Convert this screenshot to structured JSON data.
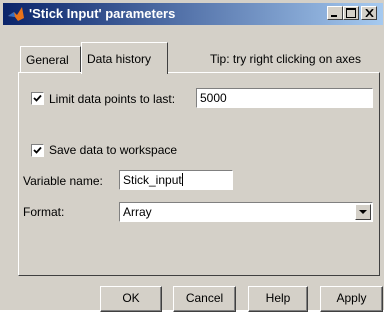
{
  "window": {
    "title": "'Stick Input' parameters",
    "accent": "#0a246a",
    "face_color": "#d4d0c8"
  },
  "tabs": [
    {
      "label": "General",
      "selected": false
    },
    {
      "label": "Data history",
      "selected": true
    }
  ],
  "tip": "Tip: try right clicking on axes",
  "data_history": {
    "limit_label": "Limit data points to last:",
    "limit_checked": true,
    "limit_value": "5000",
    "save_label": "Save data to workspace",
    "save_checked": true,
    "variable_label": "Variable name:",
    "variable_value": "Stick_input",
    "format_label": "Format:",
    "format_value": "Array"
  },
  "buttons": {
    "ok": "OK",
    "cancel": "Cancel",
    "help": "Help",
    "apply": "Apply"
  },
  "icons": {
    "app": "matlab-logo-icon",
    "minimize": "minimize-icon",
    "maximize": "maximize-icon",
    "close": "close-icon",
    "dropdown": "chevron-down-icon",
    "check": "checkmark-icon"
  }
}
